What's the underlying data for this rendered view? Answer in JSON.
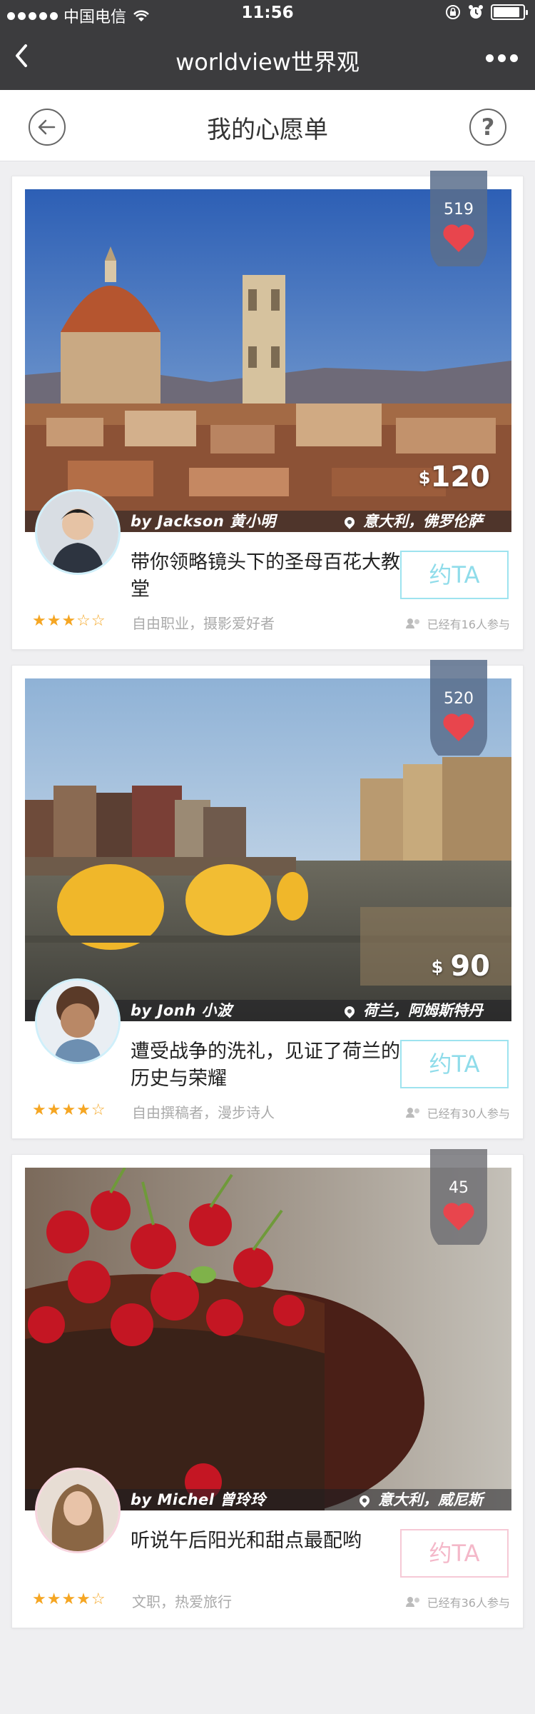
{
  "status_bar": {
    "carrier": "中国电信",
    "time": "11:56",
    "battery_level": 0.9
  },
  "navbar": {
    "back_icon": "chevron-left-icon",
    "title": "worldview世界观",
    "more_icon": "more-dots-icon"
  },
  "subheader": {
    "title": "我的心愿单",
    "back_icon": "arrow-left-circle-icon",
    "help_icon": "question-circle-icon",
    "help_glyph": "?"
  },
  "cards": [
    {
      "likes": "519",
      "price_currency": "$",
      "price": "120",
      "author": "by  Jackson 黄小明",
      "location": "意大利，佛罗伦萨",
      "title": "带你领略镜头下的圣母百花大教堂",
      "cta": "约TA",
      "rating": 3,
      "stars_text_on": "★★★",
      "stars_text_off": "☆☆",
      "occupation": "自由职业，摄影爱好者",
      "joined": "已经有16人参与"
    },
    {
      "likes": "520",
      "price_currency": "$",
      "price": "90",
      "author": "by  Jonh 小波",
      "location": "荷兰，阿姆斯特丹",
      "title": "遭受战争的洗礼，见证了荷兰的历史与荣耀",
      "cta": "约TA",
      "rating": 4,
      "stars_text_on": "★★★★",
      "stars_text_off": "☆",
      "occupation": "自由撰稿者，漫步诗人",
      "joined": "已经有30人参与"
    },
    {
      "likes": "45",
      "author": "by  Michel 曾玲玲",
      "location": "意大利，威尼斯",
      "title": "听说午后阳光和甜点最配哟",
      "cta": "约TA",
      "rating": 4,
      "stars_text_on": "★★★★",
      "stars_text_off": "☆",
      "occupation": "文职，热爱旅行",
      "joined": "已经有36人参与"
    }
  ],
  "colors": {
    "bar": "#3c3c3e",
    "heart": "#e8454d",
    "star": "#f5a623",
    "cta_blue": "#9ee3ef",
    "cta_pink": "#f6c9d6"
  }
}
